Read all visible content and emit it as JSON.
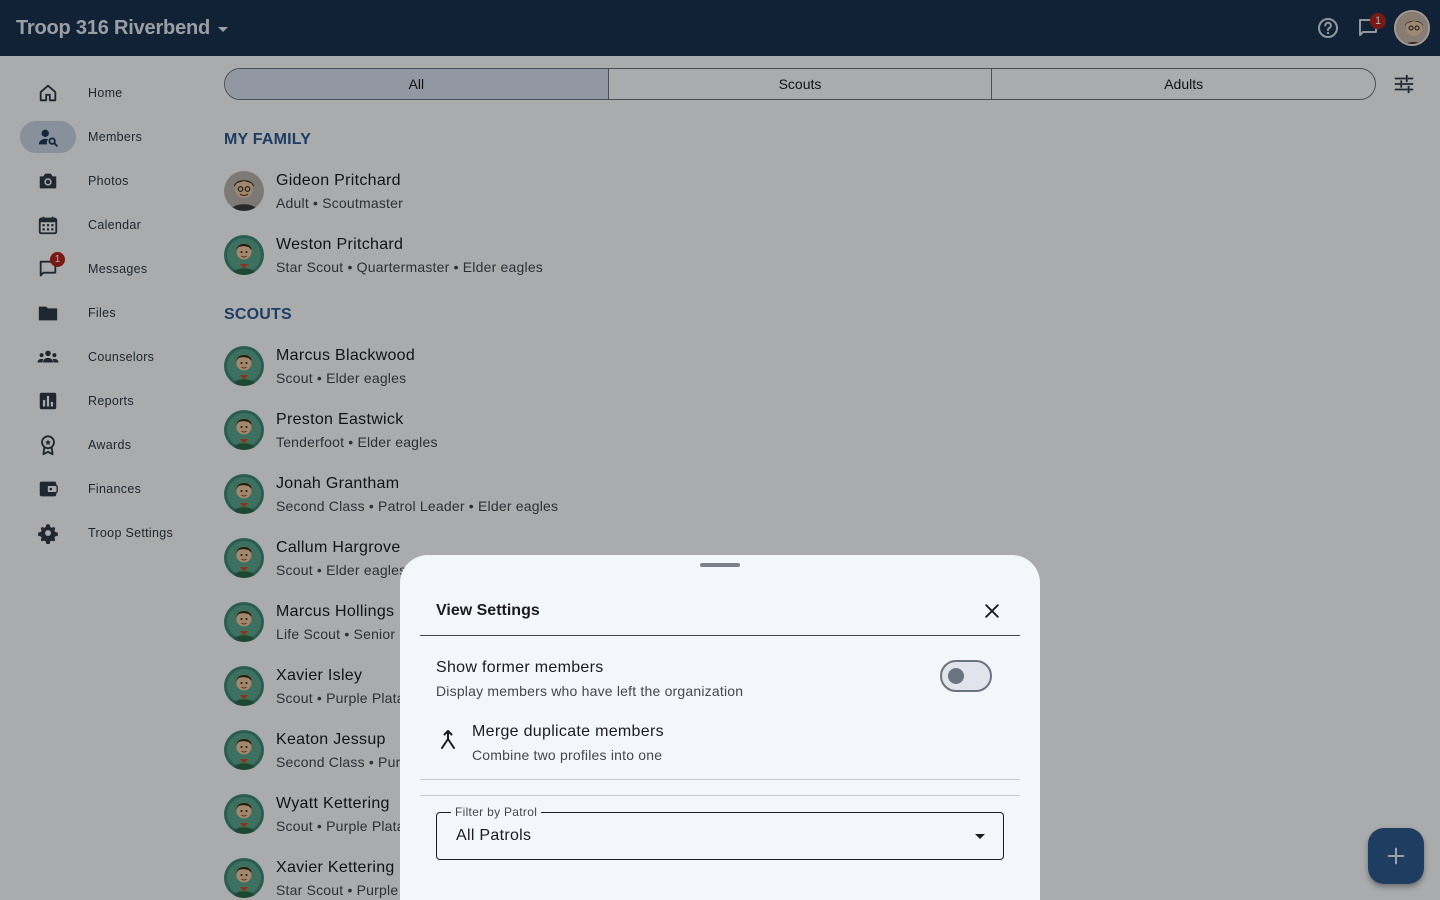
{
  "app": {
    "troop_name": "Troop 316 Riverbend"
  },
  "topbar": {
    "messages_badge": "1"
  },
  "nav": {
    "items": [
      {
        "label": "Home",
        "icon": "home-icon"
      },
      {
        "label": "Members",
        "icon": "person-search-icon",
        "active": true
      },
      {
        "label": "Photos",
        "icon": "camera-icon"
      },
      {
        "label": "Calendar",
        "icon": "calendar-icon"
      },
      {
        "label": "Messages",
        "icon": "chat-icon",
        "badge": "1"
      },
      {
        "label": "Files",
        "icon": "folder-icon"
      },
      {
        "label": "Counselors",
        "icon": "groups-icon"
      },
      {
        "label": "Reports",
        "icon": "bar-chart-icon"
      },
      {
        "label": "Awards",
        "icon": "award-icon"
      },
      {
        "label": "Finances",
        "icon": "wallet-icon"
      },
      {
        "label": "Troop Settings",
        "icon": "gear-icon"
      }
    ]
  },
  "filter_tabs": {
    "items": [
      "All",
      "Scouts",
      "Adults"
    ],
    "selected": "All"
  },
  "sections": {
    "family": {
      "title": "MY FAMILY",
      "members": [
        {
          "name": "Gideon Pritchard",
          "sub": "Adult • Scoutmaster"
        },
        {
          "name": "Weston Pritchard",
          "sub": "Star Scout • Quartermaster • Elder eagles"
        }
      ]
    },
    "scouts": {
      "title": "SCOUTS",
      "members": [
        {
          "name": "Marcus Blackwood",
          "sub": "Scout • Elder eagles"
        },
        {
          "name": "Preston Eastwick",
          "sub": "Tenderfoot • Elder eagles"
        },
        {
          "name": "Jonah Grantham",
          "sub": "Second Class • Patrol Leader • Elder eagles"
        },
        {
          "name": "Callum Hargrove",
          "sub": "Scout • Elder eagles"
        },
        {
          "name": "Marcus Hollings",
          "sub": "Life Scout • Senior P"
        },
        {
          "name": "Xavier Isley",
          "sub": "Scout • Purple Plata"
        },
        {
          "name": "Keaton Jessup",
          "sub": "Second Class • Purp"
        },
        {
          "name": "Wyatt Kettering",
          "sub": "Scout • Purple Plata"
        },
        {
          "name": "Xavier Kettering",
          "sub": "Star Scout • Purple"
        }
      ]
    }
  },
  "sheet": {
    "title": "View Settings",
    "former_members": {
      "title": "Show former members",
      "subtitle": "Display members who have left the organization",
      "enabled": false
    },
    "merge": {
      "title": "Merge duplicate members",
      "subtitle": "Combine two profiles into one"
    },
    "patrol_filter": {
      "label": "Filter by Patrol",
      "value": "All Patrols"
    }
  },
  "colors": {
    "topbar": "#1a3352",
    "accent": "#2b5a92",
    "badge": "#b3261e",
    "fab": "#2d5a8e"
  }
}
